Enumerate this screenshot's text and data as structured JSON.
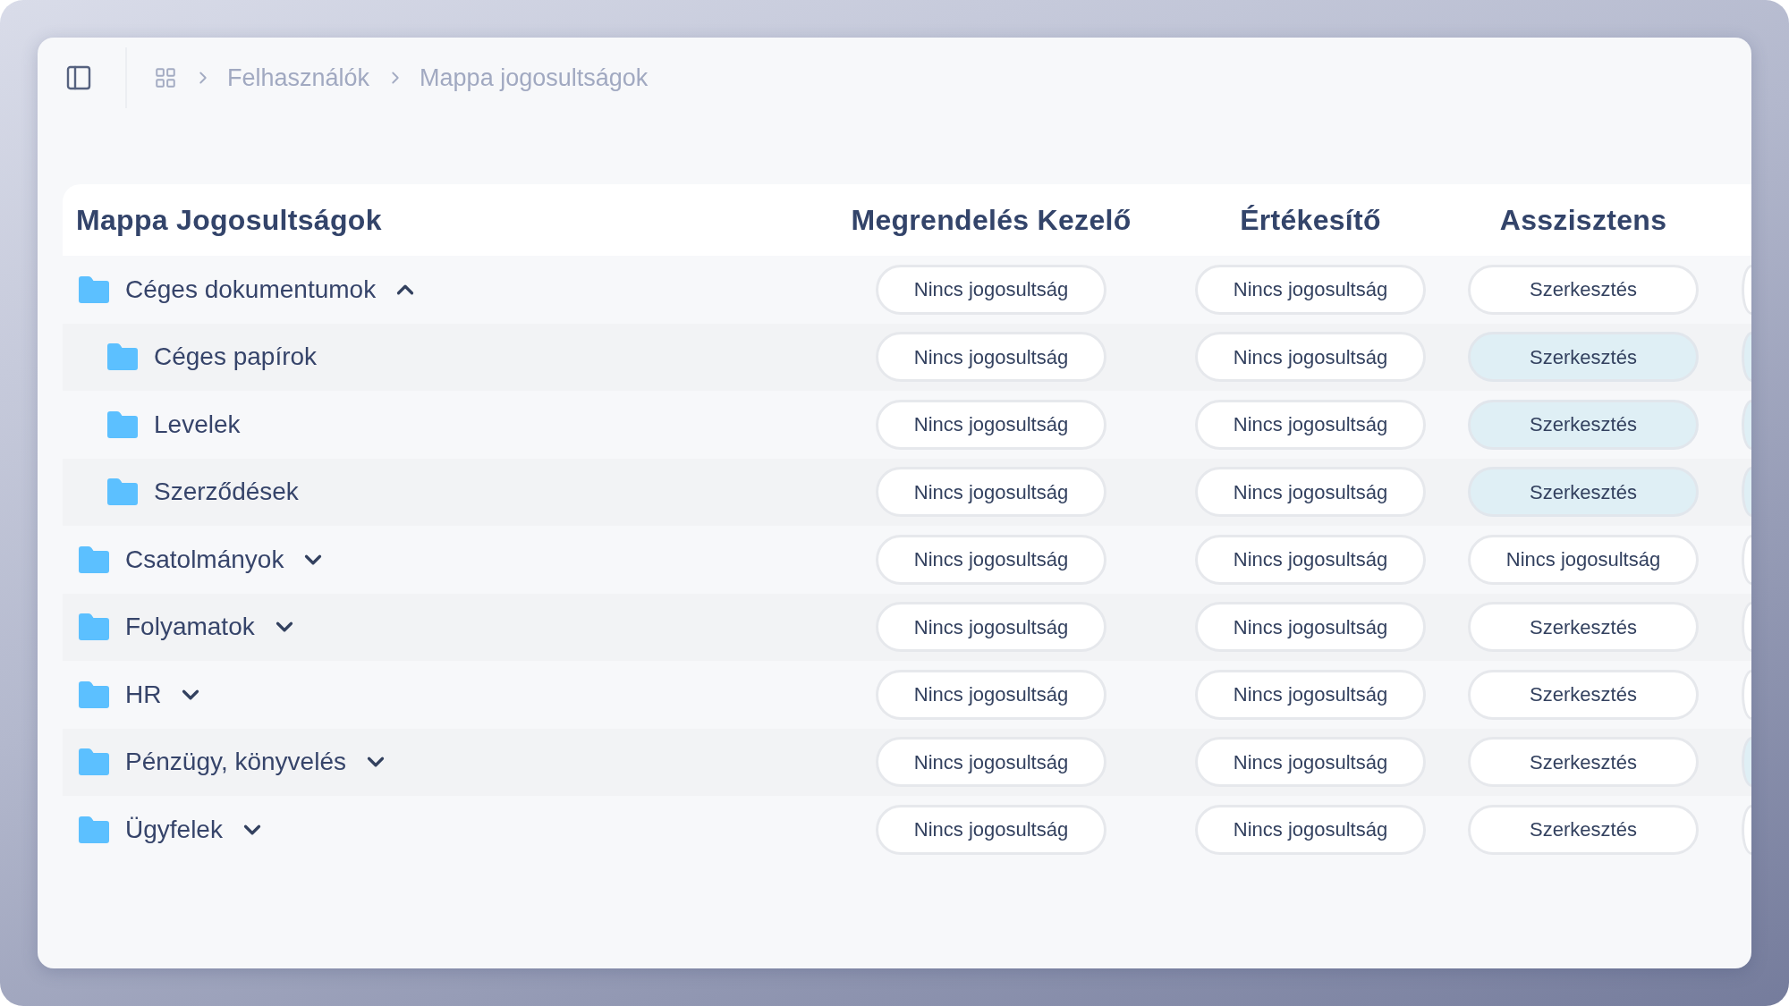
{
  "breadcrumb": [
    {
      "label": "Felhasználók"
    },
    {
      "label": "Mappa jogosultságok"
    }
  ],
  "table": {
    "title": "Mappa Jogosultságok",
    "columns": [
      "Megrendelés Kezelő",
      "Értékesítő",
      "Asszisztens"
    ],
    "rows": [
      {
        "name": "Céges dokumentumok",
        "expanded": true,
        "cells": [
          {
            "label": "Nincs jogosultság",
            "highlighted": false
          },
          {
            "label": "Nincs jogosultság",
            "highlighted": false
          },
          {
            "label": "Szerkesztés",
            "highlighted": false
          },
          {
            "highlighted": false
          }
        ],
        "children": [
          {
            "name": "Céges papírok",
            "cells": [
              {
                "label": "Nincs jogosultság",
                "highlighted": false
              },
              {
                "label": "Nincs jogosultság",
                "highlighted": false
              },
              {
                "label": "Szerkesztés",
                "highlighted": true
              },
              {
                "highlighted": true
              }
            ]
          },
          {
            "name": "Levelek",
            "cells": [
              {
                "label": "Nincs jogosultság",
                "highlighted": false
              },
              {
                "label": "Nincs jogosultság",
                "highlighted": false
              },
              {
                "label": "Szerkesztés",
                "highlighted": true
              },
              {
                "highlighted": true
              }
            ]
          },
          {
            "name": "Szerződések",
            "cells": [
              {
                "label": "Nincs jogosultság",
                "highlighted": false
              },
              {
                "label": "Nincs jogosultság",
                "highlighted": false
              },
              {
                "label": "Szerkesztés",
                "highlighted": true
              },
              {
                "highlighted": true
              }
            ]
          }
        ]
      },
      {
        "name": "Csatolmányok",
        "expanded": false,
        "cells": [
          {
            "label": "Nincs jogosultság",
            "highlighted": false
          },
          {
            "label": "Nincs jogosultság",
            "highlighted": false
          },
          {
            "label": "Nincs jogosultság",
            "highlighted": false
          },
          {
            "highlighted": false
          }
        ]
      },
      {
        "name": "Folyamatok",
        "expanded": false,
        "cells": [
          {
            "label": "Nincs jogosultság",
            "highlighted": false
          },
          {
            "label": "Nincs jogosultság",
            "highlighted": false
          },
          {
            "label": "Szerkesztés",
            "highlighted": false
          },
          {
            "highlighted": false
          }
        ]
      },
      {
        "name": "HR",
        "expanded": false,
        "cells": [
          {
            "label": "Nincs jogosultság",
            "highlighted": false
          },
          {
            "label": "Nincs jogosultság",
            "highlighted": false
          },
          {
            "label": "Szerkesztés",
            "highlighted": false
          },
          {
            "highlighted": false
          }
        ]
      },
      {
        "name": "Pénzügy, könyvelés",
        "expanded": false,
        "cells": [
          {
            "label": "Nincs jogosultság",
            "highlighted": false
          },
          {
            "label": "Nincs jogosultság",
            "highlighted": false
          },
          {
            "label": "Szerkesztés",
            "highlighted": false
          },
          {
            "highlighted": true
          }
        ]
      },
      {
        "name": "Ügyfelek",
        "expanded": false,
        "cells": [
          {
            "label": "Nincs jogosultság",
            "highlighted": false
          },
          {
            "label": "Nincs jogosultság",
            "highlighted": false
          },
          {
            "label": "Szerkesztés",
            "highlighted": false
          },
          {
            "highlighted": false
          }
        ]
      }
    ]
  }
}
